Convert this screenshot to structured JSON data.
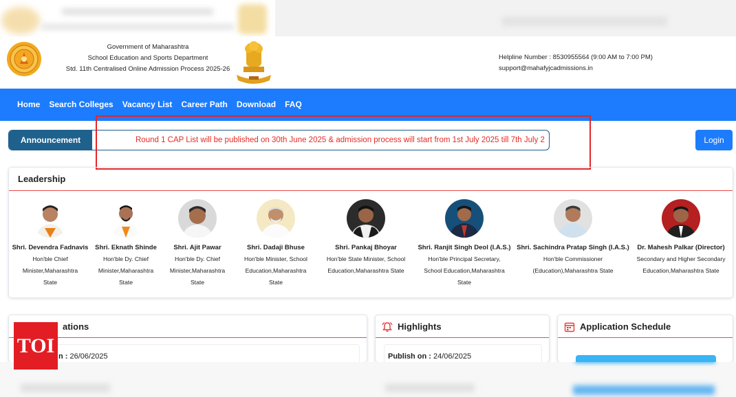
{
  "header": {
    "line1": "Government of Maharashtra",
    "line2": "School Education and Sports Department",
    "line3": "Std. 11th Centralised Online Admission Process 2025-26",
    "helpline": "Helpline Number : 8530955564 (9:00 AM to 7:00 PM)",
    "email": "support@mahafyjcadmissions.in"
  },
  "nav": [
    "Home",
    "Search Colleges",
    "Vacancy List",
    "Career Path",
    "Download",
    "FAQ"
  ],
  "announcement": {
    "label": "Announcement",
    "text": "Round 1 CAP List will be published on 30th June 2025 & admission process will start from 1st July 2025 till 7th July 2"
  },
  "login_label": "Login",
  "leadership": {
    "title": "Leadership",
    "people": [
      {
        "name": "Shri. Devendra Fadnavis",
        "role_lines": [
          "Hon'ble Chief",
          "Minister,Maharashtra",
          "State"
        ]
      },
      {
        "name": "Shri. Eknath Shinde",
        "role_lines": [
          "Hon'ble Dy. Chief",
          "Minister,Maharashtra",
          "State"
        ]
      },
      {
        "name": "Shri. Ajit Pawar",
        "role_lines": [
          "Hon'ble Dy. Chief",
          "Minister,Maharashtra",
          "State"
        ]
      },
      {
        "name": "Shri. Dadaji Bhuse",
        "role_lines": [
          "Hon'ble Minister, School",
          "Education,Maharashtra",
          "State"
        ]
      },
      {
        "name": "Shri. Pankaj Bhoyar",
        "role_lines": [
          "Hon'ble State Minister, School",
          "Education,Maharashtra State"
        ]
      },
      {
        "name": "Shri. Ranjit Singh Deol (I.A.S.)",
        "role_lines": [
          "Hon'ble Principal Secretary,",
          "School Education,Maharashtra",
          "State"
        ]
      },
      {
        "name": "Shri. Sachindra Pratap Singh (I.A.S.)",
        "role_lines": [
          "Hon'ble Commissioner",
          "(Education),Maharashtra State"
        ]
      },
      {
        "name": "Dr. Mahesh Palkar (Director)",
        "role_lines": [
          "Secondary and Higher Secondary",
          "Education,Maharashtra State"
        ]
      }
    ]
  },
  "cards": {
    "notifications": {
      "title": "ations",
      "publish_label": "n :",
      "publish_date": "26/06/2025"
    },
    "highlights": {
      "title": "Highlights",
      "publish_label": "Publish on :",
      "publish_date": "24/06/2025"
    },
    "schedule": {
      "title": "Application Schedule"
    }
  },
  "watermark": "TOI",
  "colors": {
    "nav": "#1c7cfd",
    "announcement_btn": "#1f618d",
    "announcement_text": "#e52b24",
    "accent_line": "#ea4a4a",
    "watermark": "#e31d24"
  }
}
